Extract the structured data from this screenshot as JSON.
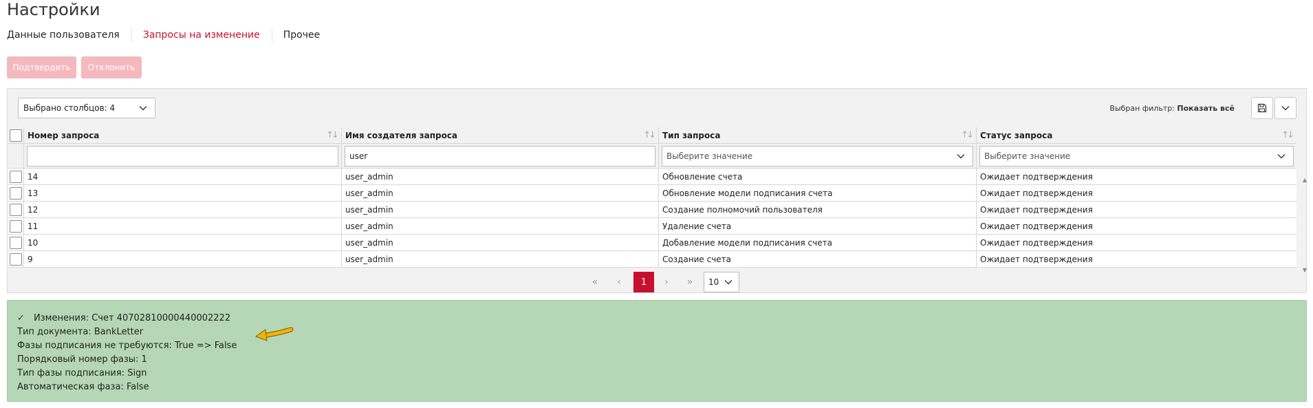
{
  "title": "Настройки",
  "tabs": [
    {
      "label": "Данные пользователя",
      "active": false
    },
    {
      "label": "Запросы на изменение",
      "active": true
    },
    {
      "label": "Прочее",
      "active": false
    }
  ],
  "actions": {
    "confirm": "Подтвердить",
    "reject": "Отклонить"
  },
  "grid": {
    "columns_selector": "Выбрано столбцов: 4",
    "filter_label": "Выбран фильтр:",
    "filter_value": "Показать всё",
    "columns": [
      "Номер запроса",
      "Имя создателя запроса",
      "Тип запроса",
      "Статус запроса"
    ],
    "filters": {
      "number": "",
      "creator": "user",
      "type_placeholder": "Выберите значение",
      "status_placeholder": "Выберите значение"
    },
    "rows": [
      {
        "number": "14",
        "creator": "user_admin",
        "type": "Обновление счета",
        "status": "Ожидает подтверждения"
      },
      {
        "number": "13",
        "creator": "user_admin",
        "type": "Обновление модели подписания счета",
        "status": "Ожидает подтверждения"
      },
      {
        "number": "12",
        "creator": "user_admin",
        "type": "Создание полномочий пользователя",
        "status": "Ожидает подтверждения"
      },
      {
        "number": "11",
        "creator": "user_admin",
        "type": "Удаление счета",
        "status": "Ожидает подтверждения"
      },
      {
        "number": "10",
        "creator": "user_admin",
        "type": "Добавление модели подписания счета",
        "status": "Ожидает подтверждения"
      },
      {
        "number": "9",
        "creator": "user_admin",
        "type": "Создание счета",
        "status": "Ожидает подтверждения"
      }
    ],
    "pager": {
      "first": "«",
      "prev": "‹",
      "current_page": "1",
      "next": "›",
      "last": "»",
      "page_size": "10"
    }
  },
  "details": {
    "header": "Изменения: Счет 40702810000440002222",
    "lines": [
      "Тип документа: BankLetter",
      "Фазы подписания не требуются: True => False",
      "Порядковый номер фазы: 1",
      "Тип фазы подписания: Sign",
      "Автоматическая фаза: False"
    ]
  },
  "colors": {
    "accent": "#c8102e",
    "button_disabled": "#f4b8bf",
    "detail_bg": "#b5d7b5",
    "arrow": "#f2b400"
  }
}
